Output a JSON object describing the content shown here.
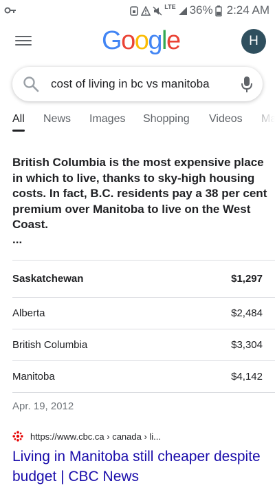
{
  "status_bar": {
    "lte": "LTE",
    "battery": "36%",
    "time": "2:24 AM",
    "icons": [
      "key-icon",
      "sim-icon",
      "warning-icon",
      "mute-icon",
      "signal-icon",
      "battery-icon"
    ]
  },
  "header": {
    "logo_letters": [
      {
        "char": "G",
        "color": "#4285F4"
      },
      {
        "char": "o",
        "color": "#EA4335"
      },
      {
        "char": "o",
        "color": "#FBBC05"
      },
      {
        "char": "g",
        "color": "#4285F4"
      },
      {
        "char": "l",
        "color": "#34A853"
      },
      {
        "char": "e",
        "color": "#EA4335"
      }
    ],
    "avatar_initial": "H"
  },
  "search": {
    "query": "cost of living in bc vs manitoba"
  },
  "tabs": [
    {
      "label": "All",
      "active": true
    },
    {
      "label": "News"
    },
    {
      "label": "Images"
    },
    {
      "label": "Shopping"
    },
    {
      "label": "Videos"
    },
    {
      "label": "Ma"
    }
  ],
  "snippet": {
    "text": "British Columbia is the most expensive place in which to live, thanks to sky-high housing costs. In fact, B.C. residents pay a 38 per cent premium over Manitoba to live on the West Coast.",
    "ellipsis": "..."
  },
  "table": {
    "header": {
      "name": "Saskatchewan",
      "value": "$1,297"
    },
    "rows": [
      {
        "name": "Alberta",
        "value": "$2,484"
      },
      {
        "name": "British Columbia",
        "value": "$3,304"
      },
      {
        "name": "Manitoba",
        "value": "$4,142"
      }
    ]
  },
  "date": "Apr. 19, 2012",
  "source": {
    "url": "https://www.cbc.ca › canada › li...",
    "favicon_color": "#E60505"
  },
  "result_title": "Living in Manitoba still cheaper despite budget | CBC News",
  "colors": {
    "link": "#1a0dab",
    "secondary_text": "#70757a",
    "avatar_bg": "#2f4f5e"
  }
}
